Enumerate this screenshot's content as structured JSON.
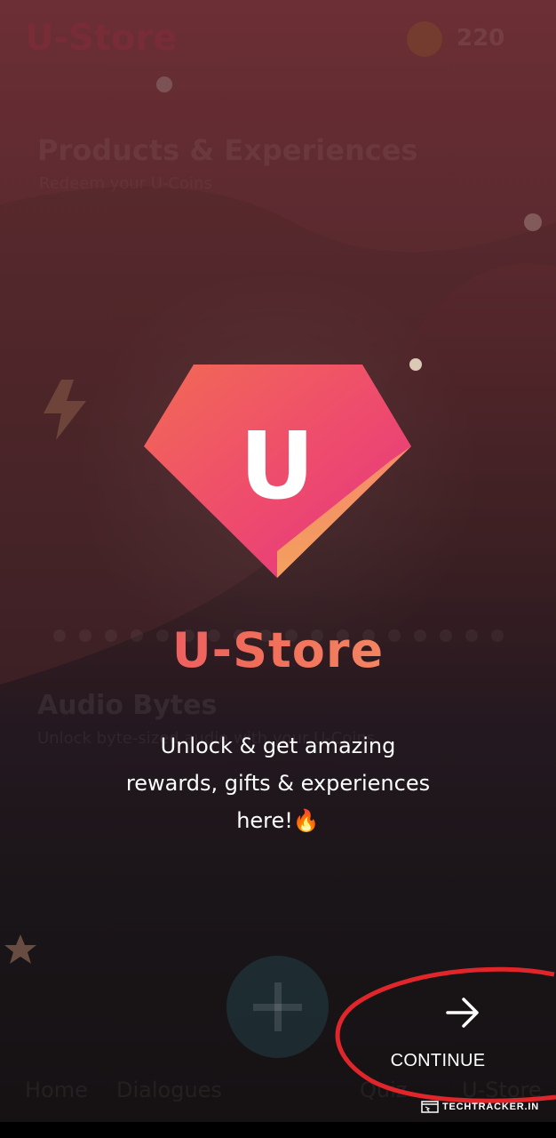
{
  "background_app": {
    "title": "U-Store",
    "coin_count": "220",
    "section1_title": "Products & Experiences",
    "section1_subtitle": "Redeem your U-Coins",
    "section2_title": "Audio Bytes",
    "section2_subtitle": "Unlock byte-sized audio with your U-Coins",
    "nav": {
      "home": "Home",
      "dialogues": "Dialogues",
      "quiz": "Quiz",
      "ustore": "U-Store"
    }
  },
  "overlay": {
    "logo_letter": "U",
    "brand": "U-Store",
    "tagline_line1": "Unlock & get amazing",
    "tagline_line2": "rewards, gifts & experiences",
    "tagline_line3": "here!🔥",
    "continue_label": "CONTINUE"
  },
  "watermark": "TECHTRACKER.IN",
  "colors": {
    "brand_gradient_start": "#e8456c",
    "brand_gradient_end": "#f9a46a",
    "highlight_ring": "#e0262a",
    "background_top": "#6e2f36",
    "background_bottom": "#161214"
  },
  "icons": [
    "lightning-icon",
    "star-icon",
    "plus-icon",
    "arrow-right-icon",
    "gem-logo-icon",
    "browser-icon"
  ]
}
